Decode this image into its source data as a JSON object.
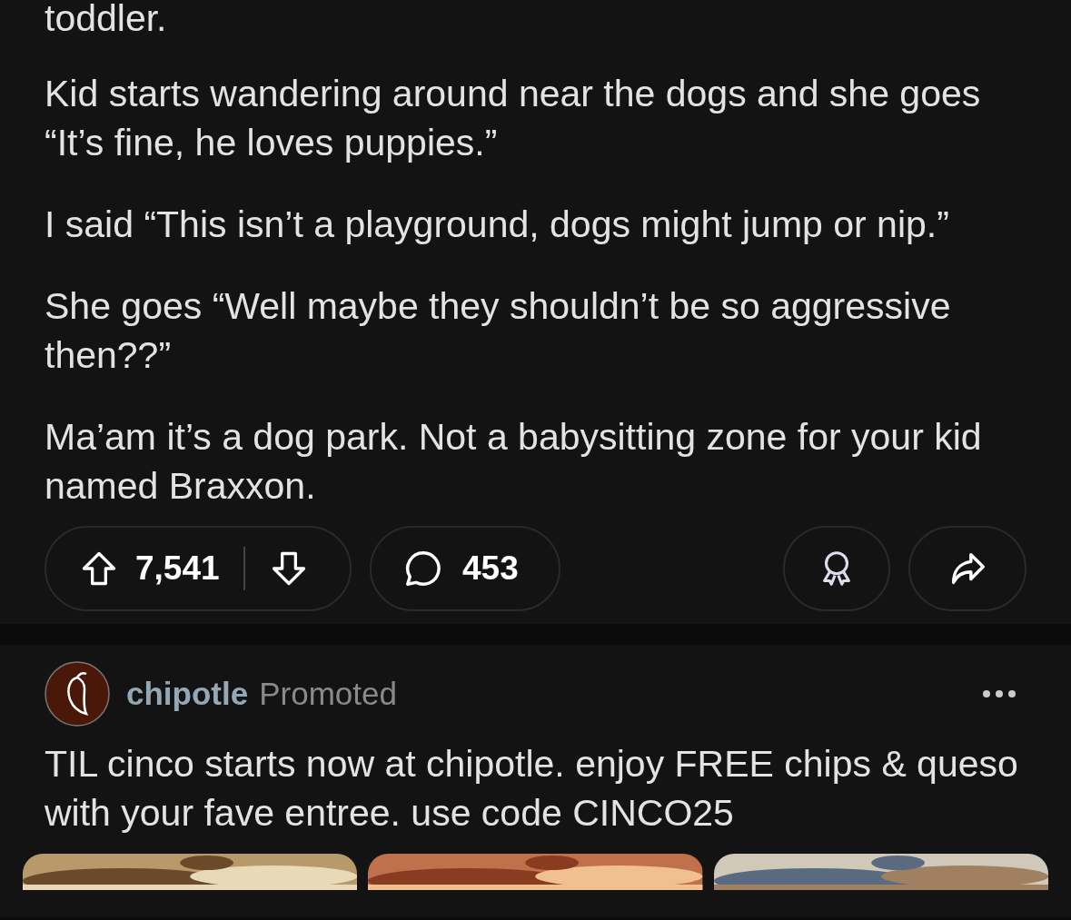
{
  "post": {
    "paragraphs": [
      "toddler.",
      "Kid starts wandering around near the dogs and she goes “It’s fine, he loves puppies.”",
      "I said “This isn’t a playground, dogs might jump or nip.”",
      "She goes “Well maybe they shouldn’t be so aggressive then??”",
      "Ma’am it’s a dog park. Not a babysitting zone for your kid named Braxxon."
    ],
    "votes": "7,541",
    "comments": "453"
  },
  "ad": {
    "author": "chipotle",
    "tag": "Promoted",
    "text": "TIL cinco starts now at chipotle. enjoy FREE chips & queso with your fave entree. use code CINCO25"
  }
}
